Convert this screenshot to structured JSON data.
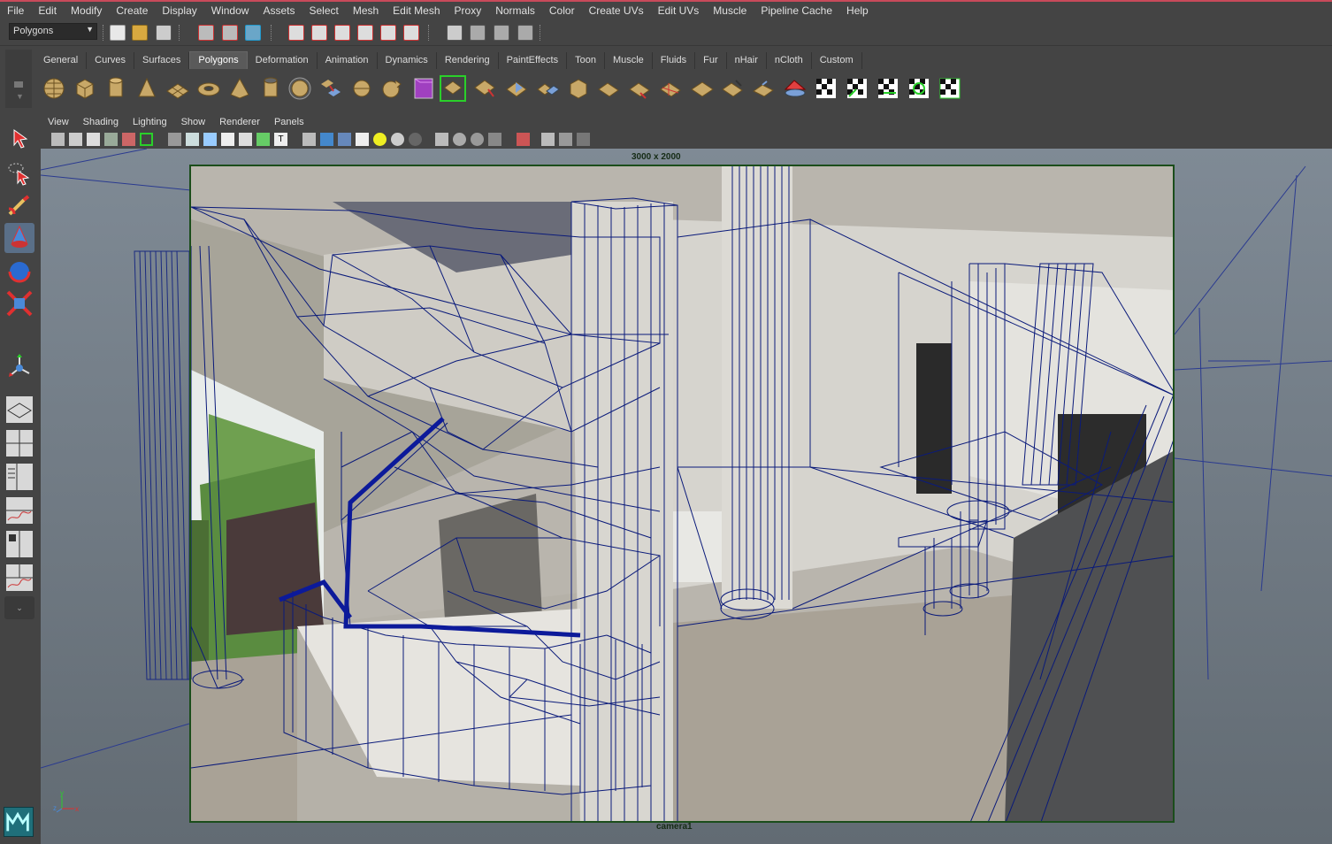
{
  "menubar": {
    "items": [
      "File",
      "Edit",
      "Modify",
      "Create",
      "Display",
      "Window",
      "Assets",
      "Select",
      "Mesh",
      "Edit Mesh",
      "Proxy",
      "Normals",
      "Color",
      "Create UVs",
      "Edit UVs",
      "Muscle",
      "Pipeline Cache",
      "Help"
    ]
  },
  "statusline": {
    "mode": "Polygons"
  },
  "shelf": {
    "tabs": [
      "General",
      "Curves",
      "Surfaces",
      "Polygons",
      "Deformation",
      "Animation",
      "Dynamics",
      "Rendering",
      "PaintEffects",
      "Toon",
      "Muscle",
      "Fluids",
      "Fur",
      "nHair",
      "nCloth",
      "Custom"
    ],
    "active_tab": "Polygons"
  },
  "panel": {
    "menus": [
      "View",
      "Shading",
      "Lighting",
      "Show",
      "Renderer",
      "Panels"
    ]
  },
  "viewport": {
    "resolution_label": "3000 x 2000",
    "camera_label": "camera1",
    "axis_x": "x",
    "axis_y": "y",
    "axis_z": "z"
  },
  "colors": {
    "accent_red": "#c84a5a",
    "wireframe": "#0a1a7a",
    "resolution_gate": "#1b4d1b",
    "viewport_bg": "#7f8a95"
  }
}
